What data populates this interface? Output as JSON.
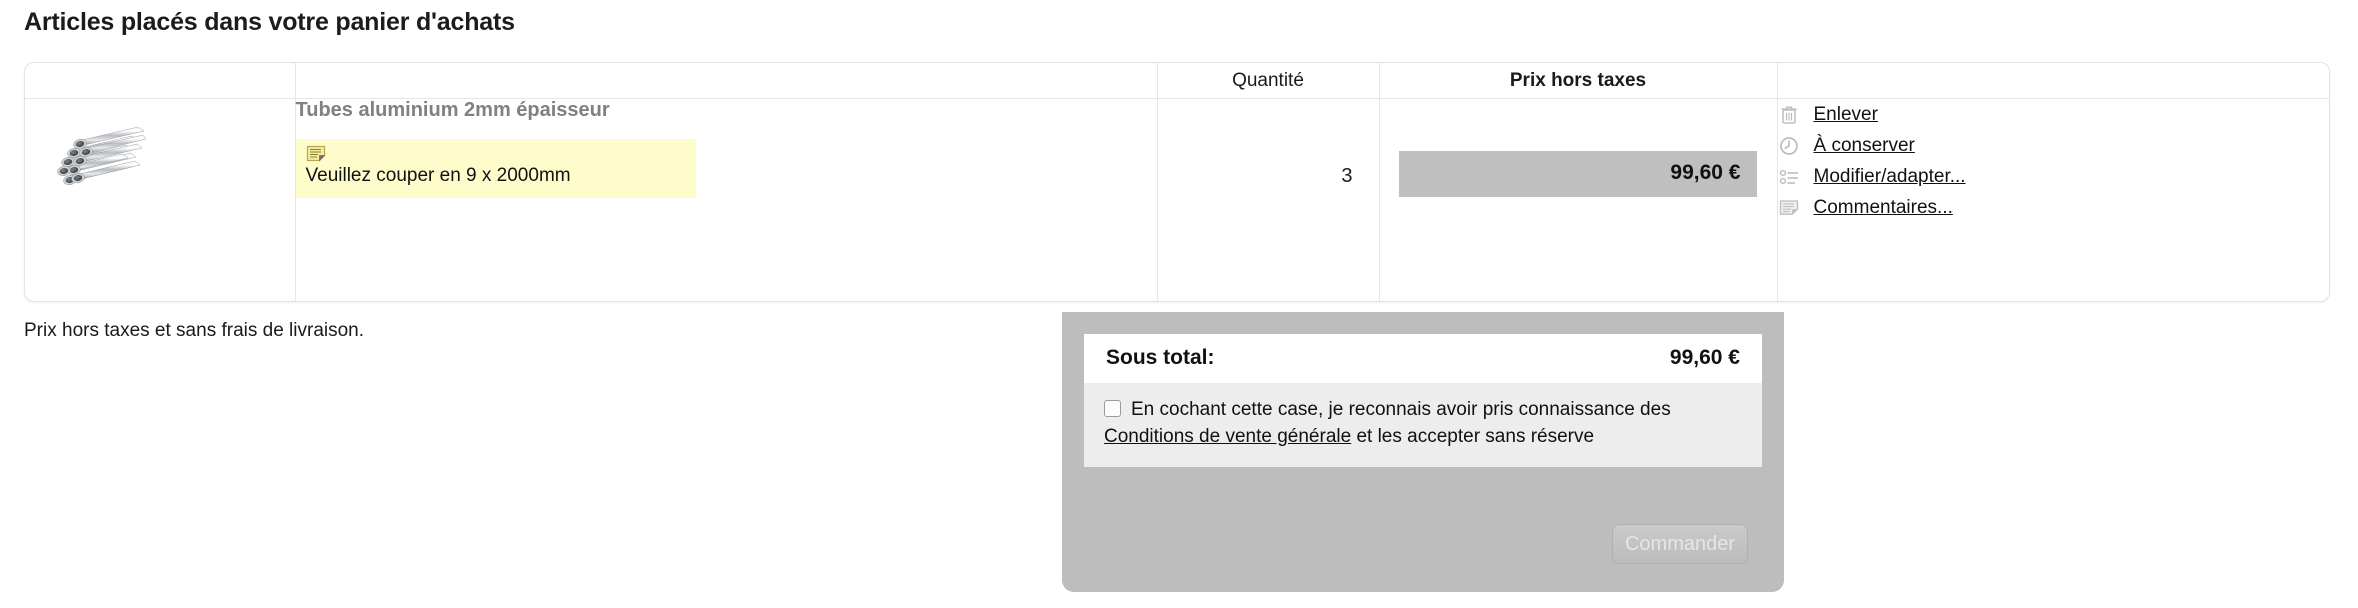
{
  "page": {
    "title": "Articles placés dans votre panier d'achats",
    "tax_note": "Prix hors taxes et sans frais de livraison."
  },
  "table": {
    "headers": {
      "image": "",
      "description": "",
      "quantity": "Quantité",
      "price": "Prix hors taxes",
      "actions": ""
    },
    "rows": [
      {
        "image_alt": "aluminium-tubes-bundle",
        "product_name": "Tubes aluminium 2mm épaisseur",
        "note_icon": "note-icon",
        "note_text": "Veuillez couper en 9 x 2000mm",
        "quantity": "3",
        "price": "99,60 €",
        "actions": [
          {
            "icon": "trash-icon",
            "label": "Enlever"
          },
          {
            "icon": "clock-icon",
            "label": "À conserver"
          },
          {
            "icon": "list-icon",
            "label": "Modifier/adapter..."
          },
          {
            "icon": "note-icon",
            "label": "Commentaires..."
          }
        ]
      }
    ]
  },
  "subtotal": {
    "label": "Sous total:",
    "amount": "99,60 €",
    "terms_part1": "En cochant cette case, je reconnais avoir pris connaissance des ",
    "terms_link": "Conditions de vente générale",
    "terms_part2": " et les accepter sans réserve",
    "order_button": "Commander"
  },
  "colors": {
    "note_background": "#fffccc",
    "price_highlight": "#bfbfbf",
    "panel_background": "#bdbdbd",
    "terms_background": "#ededed",
    "product_name": "#808080"
  }
}
